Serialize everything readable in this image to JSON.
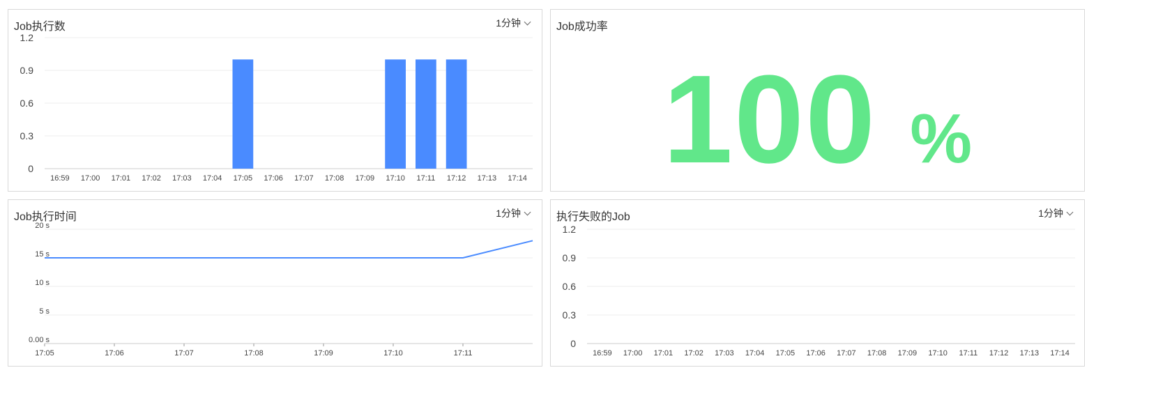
{
  "colors": {
    "bar": "#4a8bff",
    "line": "#4a8bff",
    "success": "#61e78a",
    "grid": "#eeeeee",
    "border": "#d8d8d8"
  },
  "panels": {
    "job_exec_count": {
      "title": "Job执行数",
      "interval": "1分钟"
    },
    "job_success_rate": {
      "title": "Job成功率",
      "value": "100",
      "unit": "%"
    },
    "job_exec_time": {
      "title": "Job执行时间",
      "interval": "1分钟"
    },
    "failed_jobs": {
      "title": "执行失败的Job",
      "interval": "1分钟"
    }
  },
  "chart_data": [
    {
      "type": "bar",
      "title": "Job执行数",
      "categories": [
        "16:59",
        "17:00",
        "17:01",
        "17:02",
        "17:03",
        "17:04",
        "17:05",
        "17:06",
        "17:07",
        "17:08",
        "17:09",
        "17:10",
        "17:11",
        "17:12",
        "17:13",
        "17:14"
      ],
      "values": [
        0,
        0,
        0,
        0,
        0,
        0,
        1,
        0,
        0,
        0,
        0,
        1,
        1,
        1,
        0,
        0
      ],
      "yticks": [
        "0",
        "0.3",
        "0.6",
        "0.9",
        "1.2"
      ],
      "ylim": [
        0,
        1.2
      ],
      "grid": true
    },
    {
      "type": "line",
      "title": "Job执行时间",
      "categories": [
        "17:05",
        "17:06",
        "17:07",
        "17:08",
        "17:09",
        "17:10",
        "17:11"
      ],
      "x": [
        0,
        1,
        2,
        3,
        4,
        5,
        6,
        7
      ],
      "values": [
        15,
        15,
        15,
        15,
        15,
        15,
        15,
        18
      ],
      "yticks": [
        "0.00 s",
        "5 s",
        "10 s",
        "15 s",
        "20 s"
      ],
      "ylim": [
        0,
        20
      ],
      "grid": true
    },
    {
      "type": "bar",
      "title": "执行失败的Job",
      "categories": [
        "16:59",
        "17:00",
        "17:01",
        "17:02",
        "17:03",
        "17:04",
        "17:05",
        "17:06",
        "17:07",
        "17:08",
        "17:09",
        "17:10",
        "17:11",
        "17:12",
        "17:13",
        "17:14"
      ],
      "values": [
        0,
        0,
        0,
        0,
        0,
        0,
        0,
        0,
        0,
        0,
        0,
        0,
        0,
        0,
        0,
        0
      ],
      "yticks": [
        "0",
        "0.3",
        "0.6",
        "0.9",
        "1.2"
      ],
      "ylim": [
        0,
        1.2
      ],
      "grid": true
    }
  ]
}
